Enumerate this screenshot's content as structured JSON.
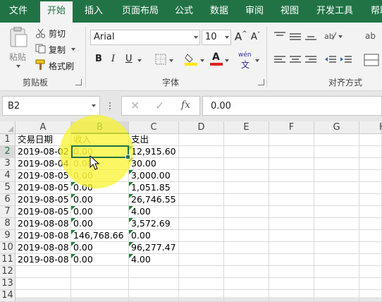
{
  "ribbon_tabs": [
    "文件",
    "开始",
    "插入",
    "页面布局",
    "公式",
    "数据",
    "审阅",
    "视图",
    "开发工具",
    "帮助"
  ],
  "active_tab": "开始",
  "clipboard": {
    "paste": "粘贴",
    "cut": "剪切",
    "copy": "复制",
    "format_painter": "格式刷",
    "group_label": "剪贴板"
  },
  "font": {
    "name": "Arial",
    "size": "10",
    "bold": "B",
    "italic": "I",
    "underline": "U",
    "font_color_glyph": "A",
    "phonetic_glyph": "wén",
    "group_label": "字体"
  },
  "alignment": {
    "group_label": "对齐方式"
  },
  "formula_bar": {
    "name_box": "B2",
    "fx_symbol": "fx",
    "value": "0.00"
  },
  "columns": [
    "A",
    "B",
    "C",
    "D",
    "E",
    "F",
    "G",
    "H"
  ],
  "rows": [
    "1",
    "2",
    "3",
    "4",
    "5",
    "6",
    "7",
    "8",
    "9",
    "10",
    "11",
    "12",
    "13",
    "14"
  ],
  "selected_cell": "B2",
  "sheet": {
    "header": [
      "交易日期",
      "收入",
      "支出"
    ],
    "data": [
      [
        "2019-08-02",
        "0.00",
        "12,915.60"
      ],
      [
        "2019-08-04",
        "0.00",
        "30.00"
      ],
      [
        "2019-08-05",
        "0.00",
        "3,000.00"
      ],
      [
        "2019-08-05",
        "0.00",
        "1,051.85"
      ],
      [
        "2019-08-05",
        "0.00",
        "26,746.55"
      ],
      [
        "2019-08-05",
        "0.00",
        "4.00"
      ],
      [
        "2019-08-08",
        "0.00",
        "3,572.69"
      ],
      [
        "2019-08-08",
        "146,768.66",
        "0.00"
      ],
      [
        "2019-08-08",
        "0.00",
        "96,277.47"
      ],
      [
        "2019-08-08",
        "0.00",
        "4.00"
      ]
    ]
  },
  "colors": {
    "accent": "#217346",
    "highlight": "#faf228",
    "error_triangle": "#1e7e34",
    "paste_highlight": "#ffe600",
    "font_color": "#e02020"
  }
}
